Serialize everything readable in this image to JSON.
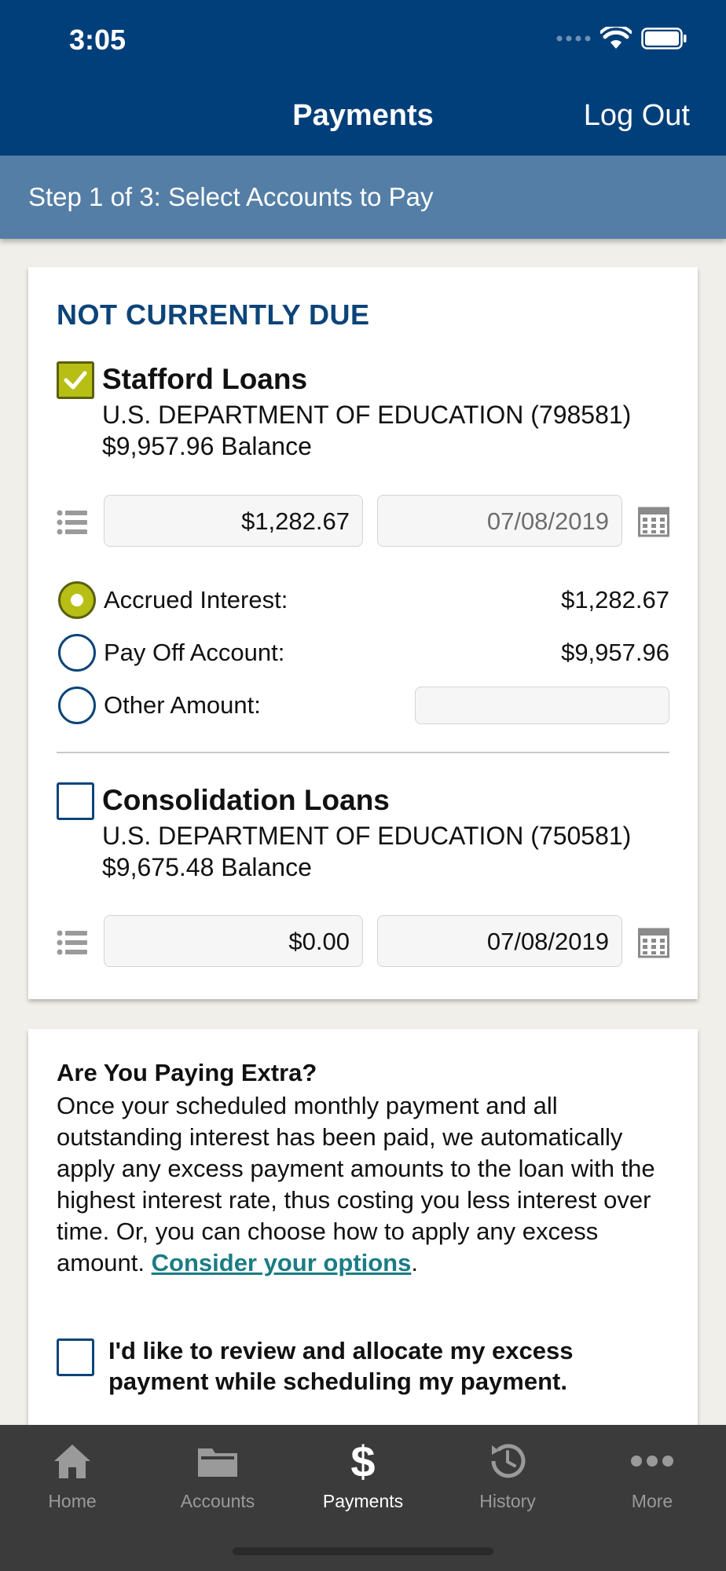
{
  "status_bar": {
    "time": "3:05"
  },
  "nav": {
    "title": "Payments",
    "logout_label": "Log Out"
  },
  "step": {
    "text": "Step 1 of 3: Select Accounts to Pay"
  },
  "due_section": {
    "title": "NOT CURRENTLY DUE",
    "loans": [
      {
        "name": "Stafford Loans",
        "lender": "U.S. DEPARTMENT OF EDUCATION (798581)",
        "balance": "$9,957.96 Balance",
        "checked": true,
        "amount": "$1,282.67",
        "date": "07/08/2019",
        "options": [
          {
            "label": "Accrued Interest:",
            "value": "$1,282.67",
            "selected": true
          },
          {
            "label": "Pay Off Account:",
            "value": "$9,957.96",
            "selected": false
          },
          {
            "label": "Other Amount:",
            "value": "",
            "selected": false
          }
        ]
      },
      {
        "name": "Consolidation Loans",
        "lender": "U.S. DEPARTMENT OF EDUCATION (750581)",
        "balance": "$9,675.48 Balance",
        "checked": false,
        "amount": "$0.00",
        "date": "07/08/2019"
      }
    ]
  },
  "extra": {
    "title": "Are You Paying Extra?",
    "body": "Once your scheduled monthly payment and all outstanding interest has been paid, we automatically apply any excess payment amounts to the loan with the highest interest rate, thus costing you less interest over time. Or, you can choose how to apply any excess amount.",
    "link": "Consider your options",
    "link_suffix": ".",
    "allocate_label": "I'd like to review and allocate my excess payment while scheduling my payment.",
    "allocate_checked": false
  },
  "tabs": [
    {
      "label": "Home",
      "icon": "home-icon",
      "active": false
    },
    {
      "label": "Accounts",
      "icon": "folder-icon",
      "active": false
    },
    {
      "label": "Payments",
      "icon": "dollar-icon",
      "active": true
    },
    {
      "label": "History",
      "icon": "history-icon",
      "active": false
    },
    {
      "label": "More",
      "icon": "more-icon",
      "active": false
    }
  ],
  "colors": {
    "header_blue": "#013f7a",
    "step_blue": "#547ea5",
    "accent_green": "#b8bf14",
    "link_teal": "#1a7c84",
    "title_blue": "#0c4479"
  }
}
